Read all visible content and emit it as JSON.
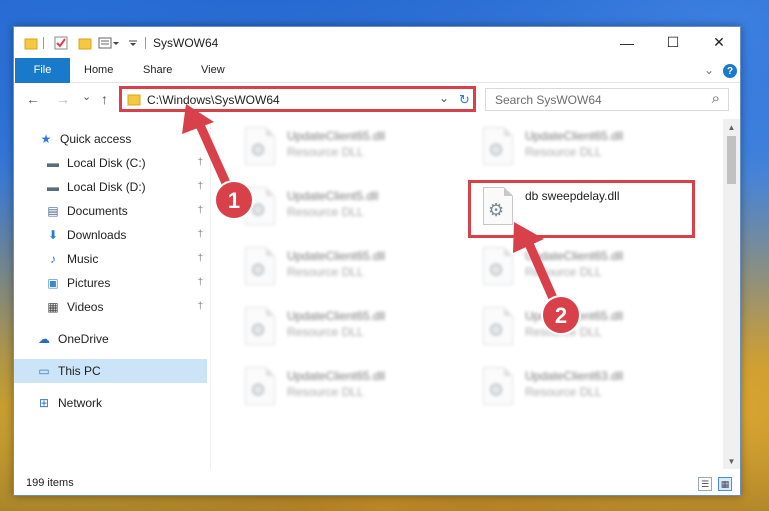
{
  "window": {
    "title": "SysWOW64",
    "controls": {
      "minimize": "—",
      "maximize": "☐",
      "close": "✕"
    }
  },
  "ribbon": {
    "tabs": [
      "File",
      "Home",
      "Share",
      "View"
    ],
    "expand_glyph": "⌄",
    "help_glyph": "?"
  },
  "nav": {
    "back": "←",
    "forward": "→",
    "recent": "⌄",
    "up": "↑",
    "address": "C:\\Windows\\SysWOW64",
    "address_dropdown": "⌄",
    "refresh": "↻",
    "search_placeholder": "Search SysWOW64",
    "search_glyph": "⌕"
  },
  "sidebar": {
    "items": [
      {
        "label": "Quick access",
        "icon": "star-icon",
        "glyph": "★",
        "color": "#2a7bd6"
      },
      {
        "label": "Local Disk (C:)",
        "icon": "drive-icon",
        "glyph": "▬",
        "color": "#5a6b7a",
        "pinned": true
      },
      {
        "label": "Local Disk (D:)",
        "icon": "drive-icon",
        "glyph": "▬",
        "color": "#5a6b7a",
        "pinned": true
      },
      {
        "label": "Documents",
        "icon": "documents-icon",
        "glyph": "▤",
        "color": "#4a6a8a",
        "pinned": true
      },
      {
        "label": "Downloads",
        "icon": "download-icon",
        "glyph": "⬇",
        "color": "#2a7bd6",
        "pinned": true
      },
      {
        "label": "Music",
        "icon": "music-icon",
        "glyph": "♪",
        "color": "#2a7bd6",
        "pinned": true
      },
      {
        "label": "Pictures",
        "icon": "pictures-icon",
        "glyph": "▣",
        "color": "#3a8ad0",
        "pinned": true
      },
      {
        "label": "Videos",
        "icon": "videos-icon",
        "glyph": "▦",
        "color": "#444",
        "pinned": true
      },
      {
        "label": "OneDrive",
        "icon": "cloud-icon",
        "glyph": "☁",
        "color": "#1f6fc4"
      },
      {
        "label": "This PC",
        "icon": "computer-icon",
        "glyph": "▭",
        "color": "#3a78c0",
        "selected": true
      },
      {
        "label": "Network",
        "icon": "network-icon",
        "glyph": "⊞",
        "color": "#3a78c0"
      }
    ],
    "pin_glyph": "📌"
  },
  "files": [
    {
      "name": "UpdateClient65.dll",
      "type": "Resource DLL"
    },
    {
      "name": "UpdateClient65.dll",
      "type": "Resource DLL"
    },
    {
      "name": "UpdateClient5.dll",
      "type": "Resource DLL"
    },
    {
      "name": "db sweepdelay.dll",
      "type": ""
    },
    {
      "name": "UpdateClient65.dll",
      "type": "Resource DLL"
    },
    {
      "name": "UpdateClient65.dll",
      "type": "Resource DLL"
    },
    {
      "name": "UpdateClient65.dll",
      "type": "Resource DLL"
    },
    {
      "name": "UpdateClient65.dll",
      "type": "Resource DLL"
    },
    {
      "name": "UpdateClient65.dll",
      "type": "Resource DLL"
    },
    {
      "name": "UpdateClient63.dll",
      "type": "Resource DLL"
    }
  ],
  "status": {
    "item_count": "199 items"
  },
  "annotations": {
    "step1": "1",
    "step2": "2",
    "color": "#d9414a"
  },
  "colors": {
    "accent": "#1979ca",
    "selection": "#cce4f7",
    "highlight": "#d9414a"
  }
}
